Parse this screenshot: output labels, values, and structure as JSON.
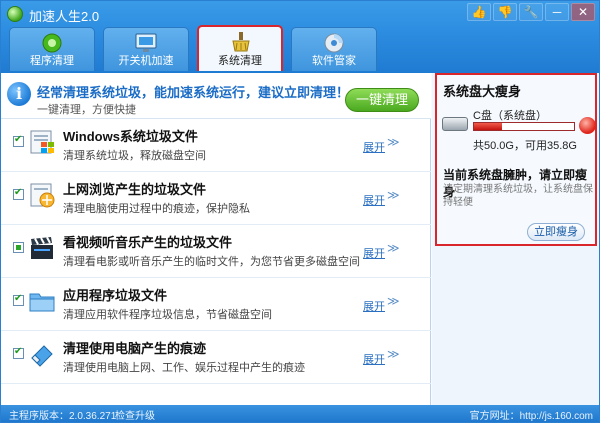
{
  "app": {
    "title": "加速人生2.0"
  },
  "window_controls": [
    "👍",
    "👎",
    "🔧",
    "─",
    "✕"
  ],
  "tabs": [
    {
      "label": "程序清理",
      "icon": "green-disc-icon"
    },
    {
      "label": "开关机加速",
      "icon": "monitor-icon"
    },
    {
      "label": "系统清理",
      "icon": "broom-icon",
      "active": true
    },
    {
      "label": "软件管家",
      "icon": "cd-icon"
    }
  ],
  "banner": {
    "title": "经常清理系统垃圾，能加速系统运行，建议立即清理！",
    "subtitle": "一键清理，方便快捷",
    "button": "一键清理"
  },
  "items": [
    {
      "title": "Windows系统垃圾文件",
      "desc": "清理系统垃圾，释放磁盘空间",
      "expand": "展开",
      "state": "checked",
      "icon": "windows-files-icon"
    },
    {
      "title": "上网浏览产生的垃圾文件",
      "desc": "清理电脑使用过程中的痕迹，保护隐私",
      "expand": "展开",
      "state": "checked",
      "icon": "browser-files-icon"
    },
    {
      "title": "看视频听音乐产生的垃圾文件",
      "desc": "清理看电影或听音乐产生的临时文件，为您节省更多磁盘空间",
      "expand": "展开",
      "state": "partial",
      "icon": "clapperboard-icon"
    },
    {
      "title": "应用程序垃圾文件",
      "desc": "清理应用软件程序垃圾信息，节省磁盘空间",
      "expand": "展开",
      "state": "checked",
      "icon": "folder-icon"
    },
    {
      "title": "清理使用电脑产生的痕迹",
      "desc": "清理使用电脑上网、工作、娱乐过程中产生的痕迹",
      "expand": "展开",
      "state": "checked",
      "icon": "eraser-icon"
    }
  ],
  "side": {
    "title": "系统盘大瘦身",
    "drive_label": "C盘（系统盘）",
    "used_fraction": 0.28,
    "stats": "共50.0G，可用35.8G",
    "warning": "当前系统盘臃肿，请立即瘦身",
    "warning_desc": "请定期清理系统垃圾，让系统盘保持轻便",
    "button": "立即瘦身"
  },
  "status": {
    "version": "主程序版本：2.0.36.271",
    "update": "检查升级",
    "site": "官方网址：http://js.160.com"
  }
}
